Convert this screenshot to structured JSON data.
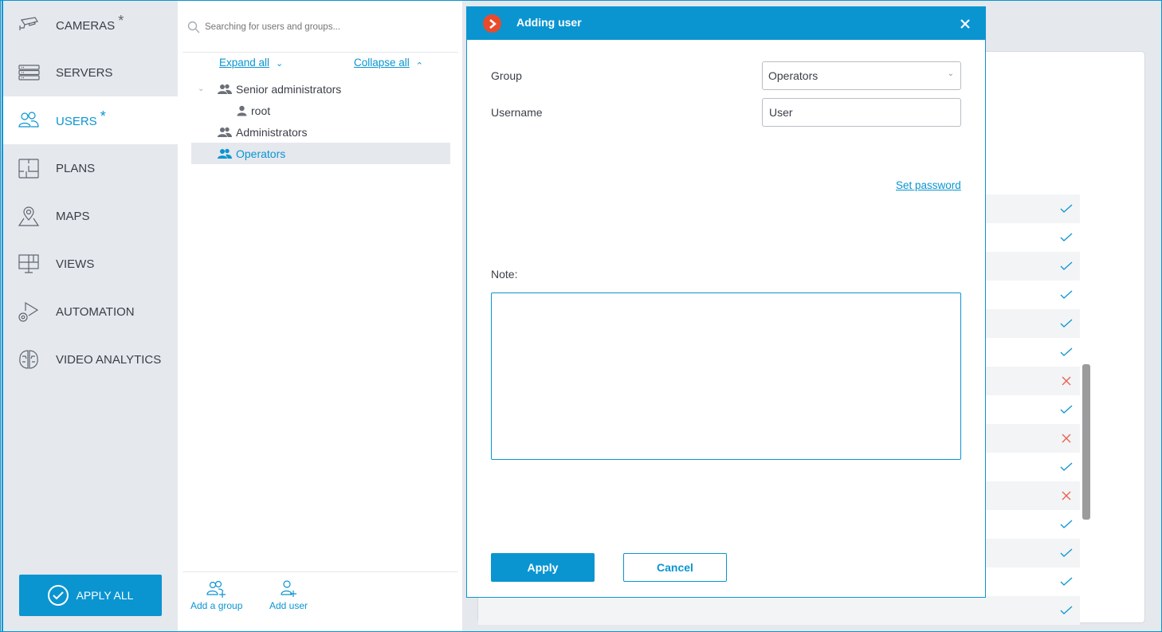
{
  "sidebar": {
    "items": [
      {
        "label": "CAMERAS",
        "icon": "camera-icon",
        "modified": true,
        "active": false
      },
      {
        "label": "SERVERS",
        "icon": "server-icon",
        "modified": false,
        "active": false
      },
      {
        "label": "USERS",
        "icon": "users-icon",
        "modified": true,
        "active": true
      },
      {
        "label": "PLANS",
        "icon": "floor-plan-icon",
        "modified": false,
        "active": false
      },
      {
        "label": "MAPS",
        "icon": "map-pin-icon",
        "modified": false,
        "active": false
      },
      {
        "label": "VIEWS",
        "icon": "monitor-grid-icon",
        "modified": false,
        "active": false
      },
      {
        "label": "AUTOMATION",
        "icon": "automation-gear-icon",
        "modified": false,
        "active": false
      },
      {
        "label": "VIDEO ANALYTICS",
        "icon": "brain-icon",
        "modified": false,
        "active": false
      }
    ],
    "modified_marker": "*",
    "apply_all_label": "APPLY ALL"
  },
  "tree": {
    "search_placeholder": "Searching for users and groups...",
    "expand_all": "Expand all",
    "collapse_all": "Collapse all",
    "nodes": [
      {
        "label": "Senior administrators",
        "type": "group",
        "expanded": true,
        "level": 0
      },
      {
        "label": "root",
        "type": "user",
        "level": 1
      },
      {
        "label": "Administrators",
        "type": "group",
        "level": 0
      },
      {
        "label": "Operators",
        "type": "group",
        "level": 0,
        "selected": true
      }
    ],
    "actions": {
      "add_group": "Add a group",
      "add_user": "Add user"
    }
  },
  "permissions": {
    "rows": [
      "allowed",
      "allowed",
      "allowed",
      "allowed",
      "allowed",
      "allowed",
      "denied",
      "allowed",
      "denied",
      "allowed",
      "denied",
      "allowed",
      "allowed",
      "allowed",
      "allowed"
    ]
  },
  "dialog": {
    "title": "Adding user",
    "group_label": "Group",
    "group_value": "Operators",
    "username_label": "Username",
    "username_value": "User",
    "set_password": "Set password",
    "note_label": "Note:",
    "note_value": "",
    "apply": "Apply",
    "cancel": "Cancel"
  },
  "colors": {
    "accent": "#0a95d1",
    "logo": "#e84b2c",
    "denied": "#e8604c"
  }
}
